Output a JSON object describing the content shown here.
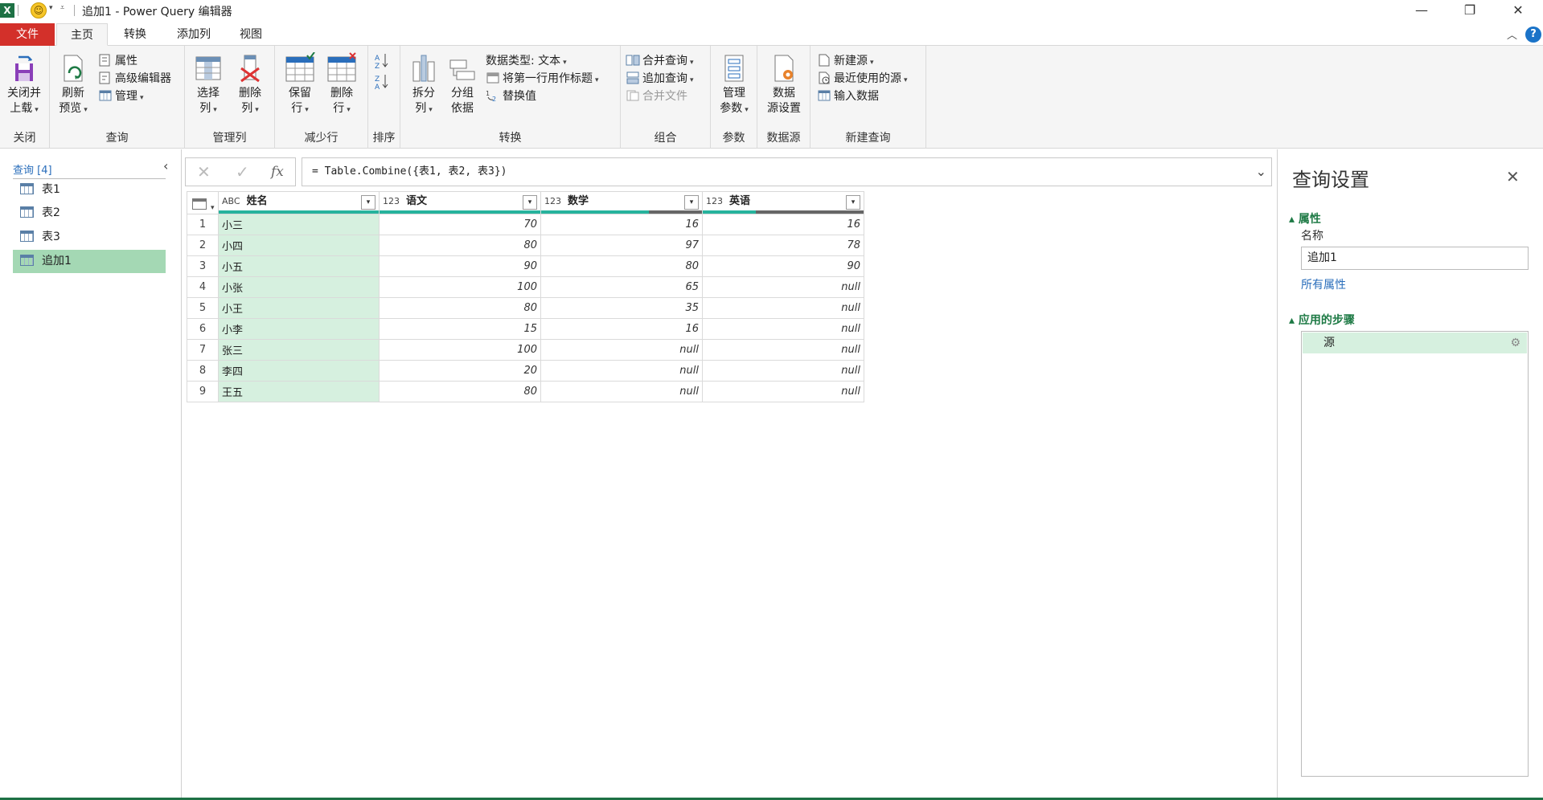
{
  "window": {
    "title": "追加1 - Power Query 编辑器",
    "app_icon": "X",
    "minimize": "—",
    "restore": "❐",
    "close": "✕"
  },
  "tabs": [
    {
      "label": "文件"
    },
    {
      "label": "主页"
    },
    {
      "label": "转换"
    },
    {
      "label": "添加列"
    },
    {
      "label": "视图"
    }
  ],
  "ribbon": {
    "close_group": {
      "btn1": "关闭并",
      "btn2": "上载",
      "label": "关闭"
    },
    "query_group": {
      "refresh1": "刷新",
      "refresh2": "预览",
      "properties": "属性",
      "advanced_editor": "高级编辑器",
      "manage": "管理",
      "label": "查询"
    },
    "manage_cols_group": {
      "choose1": "选择",
      "choose2": "列",
      "remove1": "删除",
      "remove2": "列",
      "label": "管理列"
    },
    "reduce_rows_group": {
      "keep1": "保留",
      "keep2": "行",
      "remove1": "删除",
      "remove2": "行",
      "label": "减少行"
    },
    "sort_group": {
      "label": "排序"
    },
    "transform_group": {
      "split1": "拆分",
      "split2": "列",
      "groupby1": "分组",
      "groupby2": "依据",
      "datatype": "数据类型: 文本",
      "first_row_header": "将第一行用作标题",
      "replace": "替换值",
      "label": "转换"
    },
    "combine_group": {
      "merge": "合并查询",
      "append": "追加查询",
      "combine_files": "合并文件",
      "label": "组合"
    },
    "params_group": {
      "btn1": "管理",
      "btn2": "参数",
      "label": "参数"
    },
    "datasource_group": {
      "btn1": "数据",
      "btn2": "源设置",
      "label": "数据源"
    },
    "newquery_group": {
      "new_source": "新建源",
      "recent": "最近使用的源",
      "enter_data": "输入数据",
      "label": "新建查询"
    }
  },
  "queries_pane": {
    "header": "查询 [4]",
    "items": [
      {
        "label": "表1"
      },
      {
        "label": "表2"
      },
      {
        "label": "表3"
      },
      {
        "label": "追加1"
      }
    ]
  },
  "formula_bar": {
    "formula": "= Table.Combine({表1, 表2, 表3})"
  },
  "grid": {
    "columns": [
      {
        "type": "ABC",
        "name": "姓名"
      },
      {
        "type": "123",
        "name": "语文"
      },
      {
        "type": "123",
        "name": "数学"
      },
      {
        "type": "123",
        "name": "英语"
      }
    ],
    "rows": [
      {
        "n": "1",
        "name": "小三",
        "c1": "70",
        "c2": "16",
        "c3": "16"
      },
      {
        "n": "2",
        "name": "小四",
        "c1": "80",
        "c2": "97",
        "c3": "78"
      },
      {
        "n": "3",
        "name": "小五",
        "c1": "90",
        "c2": "80",
        "c3": "90"
      },
      {
        "n": "4",
        "name": "小张",
        "c1": "100",
        "c2": "65",
        "c3": "null"
      },
      {
        "n": "5",
        "name": "小王",
        "c1": "80",
        "c2": "35",
        "c3": "null"
      },
      {
        "n": "6",
        "name": "小李",
        "c1": "15",
        "c2": "16",
        "c3": "null"
      },
      {
        "n": "7",
        "name": "张三",
        "c1": "100",
        "c2": "null",
        "c3": "null"
      },
      {
        "n": "8",
        "name": "李四",
        "c1": "20",
        "c2": "null",
        "c3": "null"
      },
      {
        "n": "9",
        "name": "王五",
        "c1": "80",
        "c2": "null",
        "c3": "null"
      }
    ],
    "quality_fill": [
      1.0,
      1.0,
      0.67,
      0.33
    ]
  },
  "settings_pane": {
    "title": "查询设置",
    "properties_section": "属性",
    "name_label": "名称",
    "name_value": "追加1",
    "all_properties": "所有属性",
    "steps_section": "应用的步骤",
    "steps": [
      {
        "label": "源"
      }
    ]
  },
  "colors": {
    "accent_green": "#1e7145",
    "file_tab": "#d3302a",
    "quality_valid": "#27b39d",
    "quality_empty": "#666666",
    "selected_bg": "#a4d8b4"
  }
}
